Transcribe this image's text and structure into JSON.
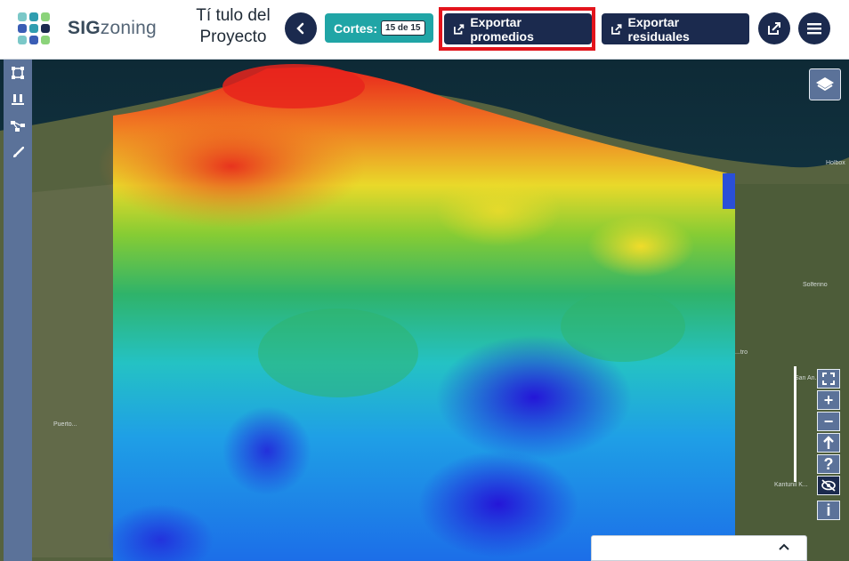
{
  "header": {
    "brand_bold": "SIG",
    "brand_light": "zoning",
    "project_title": "Tí tulo del Proyecto",
    "back_icon": "chevron-left-icon",
    "cortes_label": "Cortes:",
    "cortes_value": "15 de 15",
    "export_averages_label": "Exportar promedios",
    "export_residuals_label": "Exportar residuales",
    "export_icon": "export-icon",
    "share_icon": "share-icon",
    "menu_icon": "hamburger-menu-icon"
  },
  "toolbar": {
    "tools": [
      "polygon-select-icon",
      "flask-icon",
      "network-icon",
      "brush-icon"
    ]
  },
  "map": {
    "layers_icon": "layers-icon",
    "labels": {
      "holbox": "Holbox",
      "solferino": "Solferino",
      "san_angel": "San An...",
      "kantunil": "Kantunil K...",
      "puerto": "Puerto...",
      "rio": "...tro"
    }
  },
  "controls": {
    "fullscreen_icon": "fullscreen-icon",
    "zoom_in_label": "+",
    "zoom_out_label": "−",
    "north_icon": "arrow-up-icon",
    "help_label": "?",
    "visibility_icon": "eye-off-icon",
    "info_label": "i"
  },
  "colors": {
    "navy": "#1b2a4e",
    "teal": "#20a5a6",
    "highlight": "#e3141c",
    "toolbar": "#5b7299"
  }
}
